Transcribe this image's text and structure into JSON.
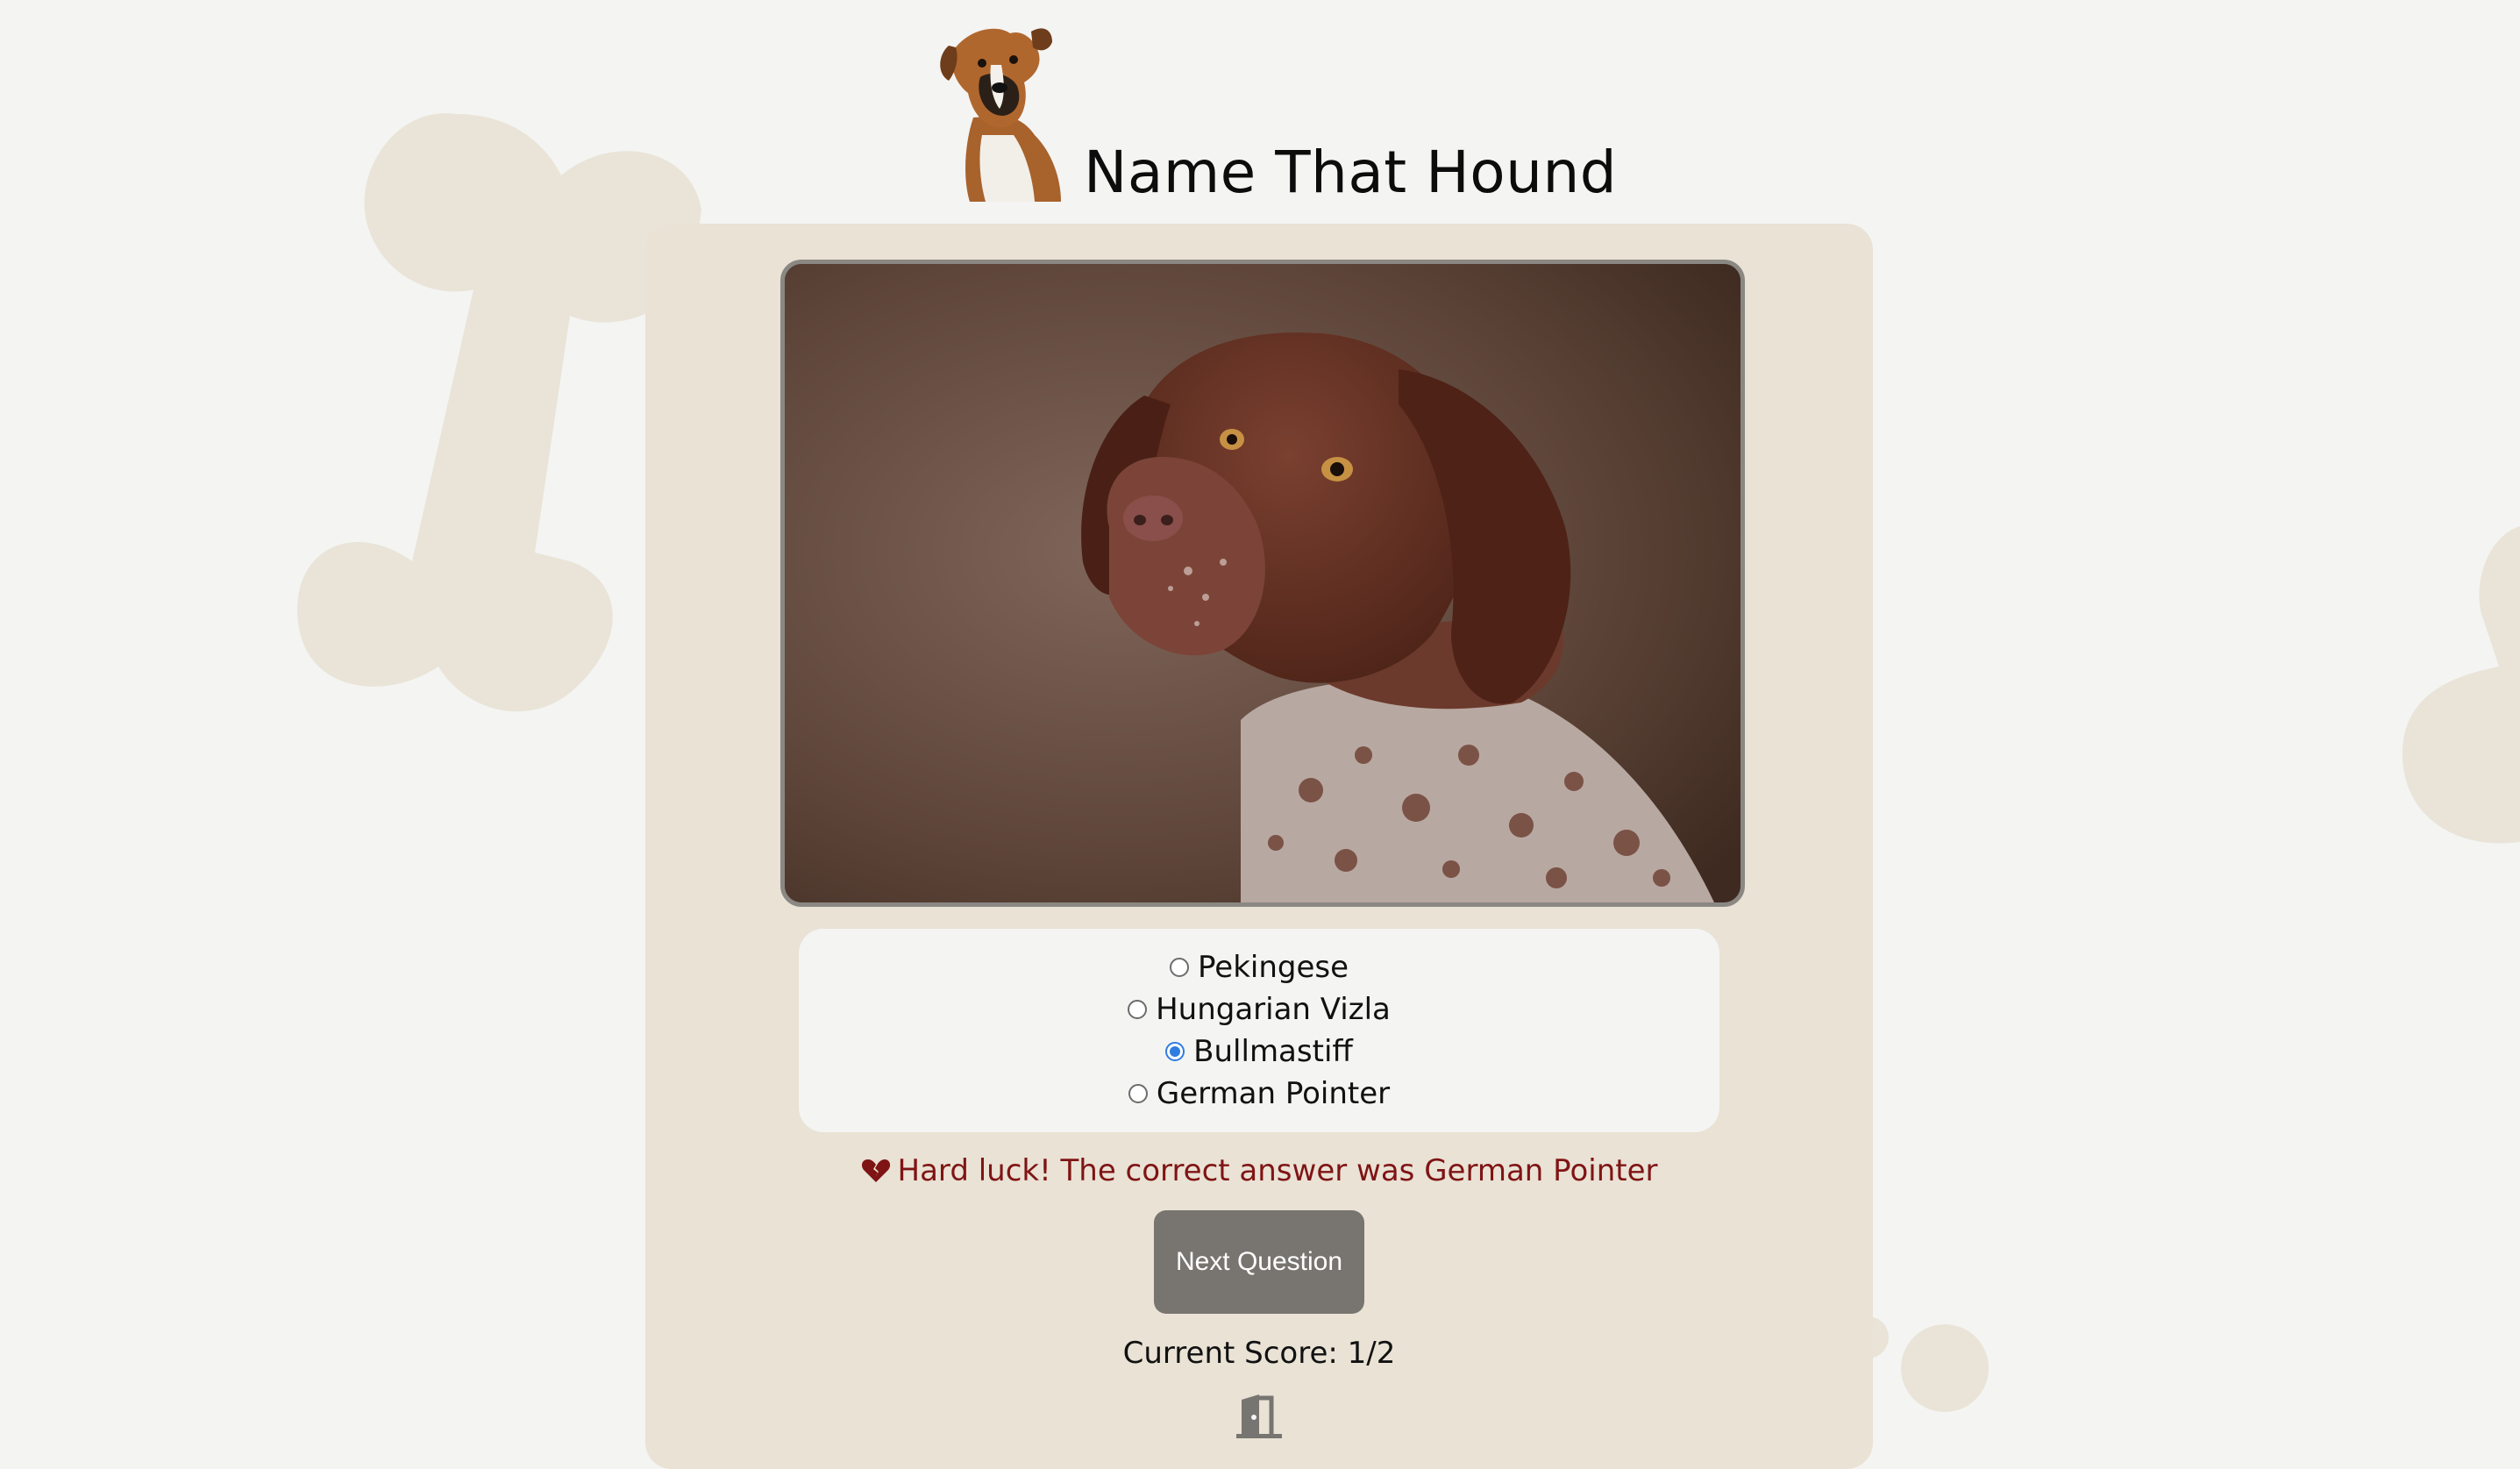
{
  "app": {
    "title": "Name That Hound"
  },
  "quiz": {
    "options": [
      {
        "label": "Pekingese",
        "selected": false
      },
      {
        "label": "Hungarian Vizla",
        "selected": false
      },
      {
        "label": "Bullmastiff",
        "selected": true
      },
      {
        "label": "German Pointer",
        "selected": false
      }
    ],
    "feedback": "Hard luck! The correct answer was German Pointer",
    "next_button": "Next Question",
    "score": "Current Score: 1/2"
  },
  "icons": {
    "logo": "boxer-dog-logo",
    "feedback": "broken-heart-icon",
    "exit": "exit-door-icon",
    "photo": "dog-photo"
  },
  "colors": {
    "background": "#f4f4f3",
    "card": "#e9e2d5",
    "bone": "#e9e4d7",
    "feedback_text": "#7f1414",
    "button": "#787570",
    "radio_selected": "#2f7de1"
  }
}
